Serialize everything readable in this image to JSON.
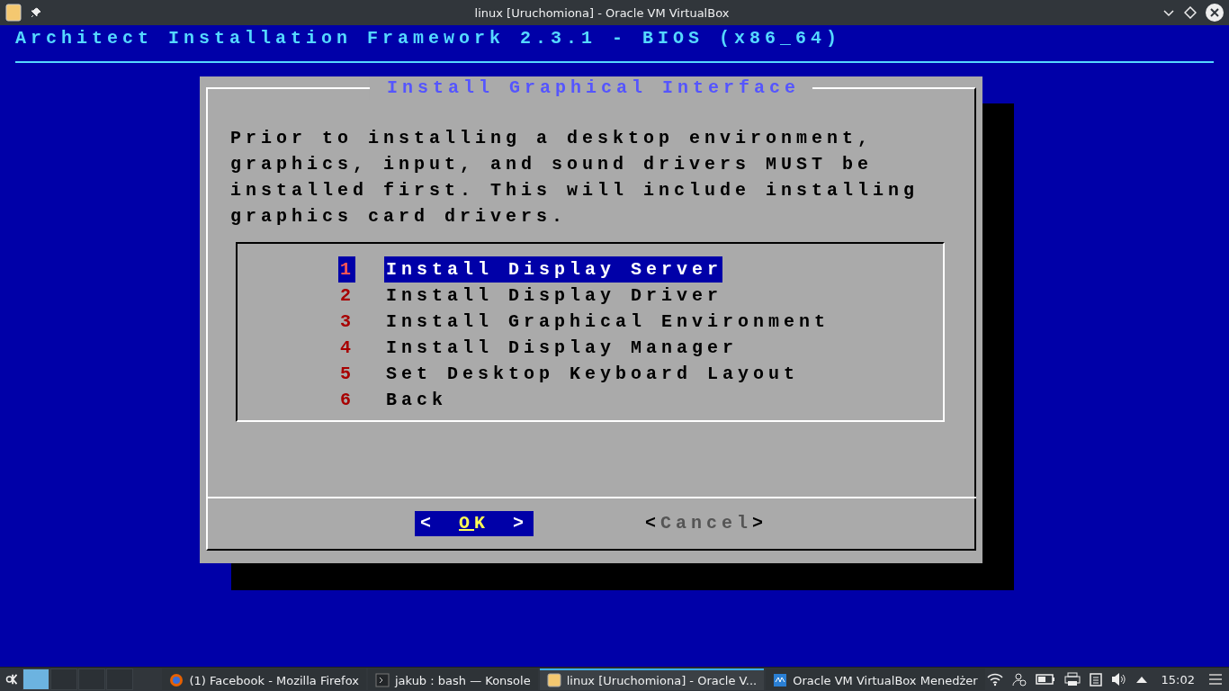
{
  "window": {
    "title": "linux [Uruchomiona] - Oracle VM VirtualBox"
  },
  "console": {
    "header": "Architect Installation Framework 2.3.1 - BIOS (x86_64)"
  },
  "dialog": {
    "title": "Install Graphical Interface",
    "text": "Prior to installing a desktop environment, graphics, input, and sound drivers MUST be installed first. This will include installing graphics card drivers.",
    "menu": [
      {
        "tag": "1",
        "label": "Install Display Server",
        "selected": true
      },
      {
        "tag": "2",
        "label": "Install Display Driver",
        "selected": false
      },
      {
        "tag": "3",
        "label": "Install Graphical Environment",
        "selected": false
      },
      {
        "tag": "4",
        "label": "Install Display Manager",
        "selected": false
      },
      {
        "tag": "5",
        "label": "Set Desktop Keyboard Layout",
        "selected": false
      },
      {
        "tag": "6",
        "label": "Back",
        "selected": false
      }
    ],
    "buttons": [
      {
        "open": "<",
        "label": "OK",
        "close": ">",
        "selected": true
      },
      {
        "open": "<",
        "label": "Cancel",
        "close": ">",
        "selected": false
      }
    ]
  },
  "taskbar": {
    "pager": [
      {
        "selected": true
      },
      {
        "selected": false
      },
      {
        "selected": false
      },
      {
        "selected": false
      }
    ],
    "tasks": [
      {
        "kind": "firefox",
        "label": "(1) Facebook - Mozilla Firefox",
        "selected": false
      },
      {
        "kind": "terminal",
        "label": "jakub : bash — Konsole",
        "selected": false
      },
      {
        "kind": "vbox",
        "label": "linux [Uruchomiona] - Oracle V...",
        "selected": true
      },
      {
        "kind": "manager",
        "label": "Oracle VM VirtualBox Menedżer",
        "selected": false
      }
    ],
    "clock": "15:02"
  }
}
